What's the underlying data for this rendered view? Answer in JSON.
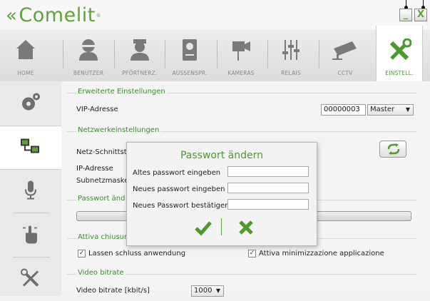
{
  "app": {
    "logo_text": "Comelit",
    "logo_mark": "«"
  },
  "window": {
    "minimize_label": "_",
    "close_label": "X"
  },
  "tabs": [
    {
      "label": "HOME",
      "icon": "home-icon"
    },
    {
      "label": "BENUTZER",
      "icon": "user-icon"
    },
    {
      "label": "PFÖRTNERZ.",
      "icon": "doorman-icon"
    },
    {
      "label": "AUSSENSPR.",
      "icon": "outdoor-station-icon"
    },
    {
      "label": "KAMERAS",
      "icon": "camera-icon"
    },
    {
      "label": "RELAIS",
      "icon": "relay-icon"
    },
    {
      "label": "CCTV",
      "icon": "cctv-icon"
    },
    {
      "label": "EINSTELL.",
      "icon": "settings-tools-icon",
      "active": true
    }
  ],
  "left_nav": [
    {
      "icon": "gears-icon"
    },
    {
      "icon": "network-icon",
      "active": true
    },
    {
      "icon": "microphone-icon"
    },
    {
      "icon": "touch-icon"
    },
    {
      "icon": "tools-icon"
    }
  ],
  "sections": {
    "advanced": {
      "title": "Erweiterte Einstellungen",
      "vip_label": "VIP-Adresse",
      "vip_value": "00000003",
      "role_value": "Master"
    },
    "network": {
      "title": "Netzwerkeinstellungen",
      "interface_label": "Netz-Schnittst",
      "ip_label": "IP-Adresse",
      "subnet_label": "Subnetzmaske"
    },
    "password": {
      "title": "Passwort änd"
    },
    "closing": {
      "title": "Attiva chiusur",
      "checkbox1_label": "Lassen schluss anwendung",
      "checkbox2_label": "Attiva minimizzazione applicazione"
    },
    "video": {
      "title": "Video bitrate",
      "bitrate_label": "Video bitrate [kbit/s]",
      "bitrate_value": "1000"
    }
  },
  "dialog": {
    "title": "Passwort ändern",
    "old_label": "Altes passwort eingeben",
    "new_label": "Neues passwort eingeben",
    "confirm_label": "Neues Passwort bestätigen",
    "old_value": "",
    "new_value": "",
    "confirm_value": ""
  },
  "colors": {
    "accent": "#5ca437",
    "section_title": "#3a8d2a",
    "dialog_title": "#4b9a2d"
  }
}
